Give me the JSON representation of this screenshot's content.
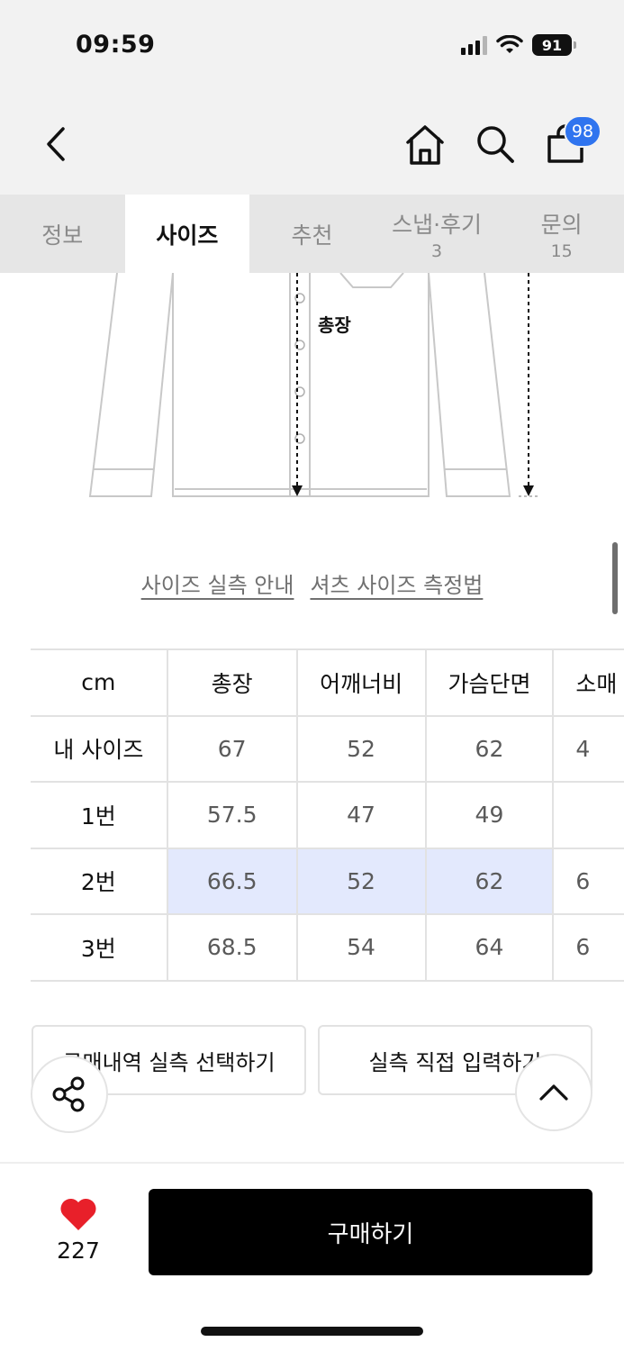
{
  "status": {
    "time": "09:59",
    "battery": "91"
  },
  "header": {
    "back_icon": "chevron-left-icon",
    "home_icon": "home-icon",
    "search_icon": "search-icon",
    "cart_icon": "shopping-bag-icon",
    "cart_count": "98",
    "badge_color": "#2f74ef"
  },
  "tabs": [
    {
      "label": "정보",
      "count": ""
    },
    {
      "label": "사이즈",
      "count": ""
    },
    {
      "label": "추천",
      "count": ""
    },
    {
      "label": "스냅·후기",
      "count": "3"
    },
    {
      "label": "문의",
      "count": "15"
    }
  ],
  "active_tab": "사이즈",
  "diagram": {
    "label": "총장"
  },
  "links": {
    "size_guide": "사이즈 실측 안내",
    "measure_method": "셔츠 사이즈 측정법"
  },
  "size_table": {
    "columns": [
      "cm",
      "총장",
      "어깨너비",
      "가슴단면",
      "소매"
    ],
    "rows": [
      {
        "label": "내 사이즈",
        "values": [
          "67",
          "52",
          "62",
          "4"
        ]
      },
      {
        "label": "1번",
        "values": [
          "57.5",
          "47",
          "49",
          ""
        ]
      },
      {
        "label": "2번",
        "values": [
          "66.5",
          "52",
          "62",
          "6"
        ]
      },
      {
        "label": "3번",
        "values": [
          "68.5",
          "54",
          "64",
          "6"
        ]
      }
    ],
    "highlight_row": "2번",
    "highlight_color": "#e3e9fd"
  },
  "buttons": {
    "history": "구매내역 실측 선택하기",
    "direct": "실측 직접 입력하기"
  },
  "floating": {
    "share_icon": "share-icon",
    "top_icon": "chevron-up-icon"
  },
  "bottom": {
    "like_icon": "heart-icon",
    "like_count": "227",
    "like_color": "#e8202a",
    "buy": "구매하기"
  }
}
